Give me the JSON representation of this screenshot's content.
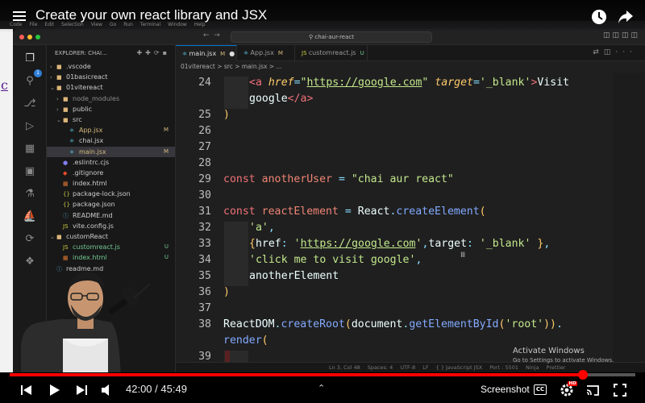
{
  "video": {
    "title": "Create your own react library and JSX",
    "time_current": "42:00",
    "time_total": "45:49",
    "time_separator": "/",
    "progress": 0.916,
    "screenshot_label": "Screenshot",
    "cc_label": "CC",
    "hd_label": "HD"
  },
  "mac_menubar": [
    "Code",
    "File",
    "Edit",
    "Selection",
    "View",
    "Go",
    "Run",
    "Terminal",
    "Window",
    "Help"
  ],
  "vscode": {
    "command_center": "chai-aur-react",
    "activity_badge": "1",
    "explorer_title": "EXPLORER: CHAI...",
    "tree": [
      {
        "label": ".vscode",
        "depth": 1,
        "kind": "folder",
        "open": false,
        "status": "",
        "color": "#cccccc"
      },
      {
        "label": "01basicreact",
        "depth": 1,
        "kind": "folder",
        "open": false,
        "status": "",
        "color": "#cccccc"
      },
      {
        "label": "01vitereact",
        "depth": 1,
        "kind": "folder",
        "open": true,
        "status": "",
        "color": "#cccccc"
      },
      {
        "label": "node_modules",
        "depth": 2,
        "kind": "folder",
        "open": false,
        "status": "",
        "color": "#8c8c8c"
      },
      {
        "label": "public",
        "depth": 2,
        "kind": "folder",
        "open": false,
        "status": "",
        "color": "#cccccc"
      },
      {
        "label": "src",
        "depth": 2,
        "kind": "folder",
        "open": true,
        "status": "",
        "color": "#cccccc"
      },
      {
        "label": "App.jsx",
        "depth": 3,
        "kind": "react",
        "open": false,
        "status": "M",
        "color": "#d7ba7d"
      },
      {
        "label": "chai.jsx",
        "depth": 3,
        "kind": "react",
        "open": false,
        "status": "",
        "color": "#cccccc"
      },
      {
        "label": "main.jsx",
        "depth": 3,
        "kind": "react",
        "open": false,
        "status": "M",
        "color": "#d7ba7d",
        "selected": true
      },
      {
        "label": ".eslintrc.cjs",
        "depth": 2,
        "kind": "eslint",
        "open": false,
        "status": "",
        "color": "#cccccc"
      },
      {
        "label": ".gitignore",
        "depth": 2,
        "kind": "git",
        "open": false,
        "status": "",
        "color": "#cccccc"
      },
      {
        "label": "index.html",
        "depth": 2,
        "kind": "html",
        "open": false,
        "status": "",
        "color": "#cccccc"
      },
      {
        "label": "package-lock.json",
        "depth": 2,
        "kind": "json",
        "open": false,
        "status": "",
        "color": "#cccccc"
      },
      {
        "label": "package.json",
        "depth": 2,
        "kind": "json",
        "open": false,
        "status": "",
        "color": "#cccccc"
      },
      {
        "label": "README.md",
        "depth": 2,
        "kind": "info",
        "open": false,
        "status": "",
        "color": "#cccccc"
      },
      {
        "label": "vite.config.js",
        "depth": 2,
        "kind": "js",
        "open": false,
        "status": "",
        "color": "#cccccc"
      },
      {
        "label": "customReact",
        "depth": 1,
        "kind": "folder",
        "open": true,
        "status": "",
        "color": "#cccccc"
      },
      {
        "label": "customreact.js",
        "depth": 2,
        "kind": "js",
        "open": false,
        "status": "U",
        "color": "#73c991"
      },
      {
        "label": "index.html",
        "depth": 2,
        "kind": "html",
        "open": false,
        "status": "U",
        "color": "#73c991"
      },
      {
        "label": "readme.md",
        "depth": 1,
        "kind": "info",
        "open": false,
        "status": "",
        "color": "#cccccc"
      }
    ],
    "tabs": [
      {
        "label": "main.jsx",
        "status": "M",
        "active": true,
        "dirty": true
      },
      {
        "label": "App.jsx",
        "status": "M",
        "active": false,
        "dirty": false
      },
      {
        "label": "customreact.js",
        "status": "U",
        "active": false,
        "dirty": false
      }
    ],
    "breadcrumb": "01vitereact > src > main.jsx > ...",
    "lines": [
      {
        "n": "24",
        "indent": 1,
        "tokens": [
          [
            "tag",
            "<a "
          ],
          [
            "attr",
            "href"
          ],
          [
            "punc",
            "="
          ],
          [
            "str",
            "\""
          ],
          [
            "str lnk",
            "https://google.com"
          ],
          [
            "str",
            "\""
          ],
          [
            "plain",
            " "
          ],
          [
            "attr",
            "target"
          ],
          [
            "punc",
            "="
          ],
          [
            "str",
            "'_blank'"
          ],
          [
            "tag",
            ">"
          ],
          [
            "plain",
            "Visit"
          ]
        ]
      },
      {
        "n": "",
        "indent": 1,
        "tokens": [
          [
            "plain",
            "google"
          ],
          [
            "tag",
            "</a>"
          ]
        ]
      },
      {
        "n": "25",
        "indent": 0,
        "tokens": [
          [
            "par",
            ")"
          ]
        ]
      },
      {
        "n": "26",
        "indent": 0,
        "tokens": []
      },
      {
        "n": "27",
        "indent": 0,
        "tokens": []
      },
      {
        "n": "28",
        "indent": 0,
        "tokens": []
      },
      {
        "n": "29",
        "indent": 0,
        "tokens": [
          [
            "kw",
            "const "
          ],
          [
            "var",
            "anotherUser"
          ],
          [
            "plain",
            " "
          ],
          [
            "punc",
            "="
          ],
          [
            "plain",
            " "
          ],
          [
            "str",
            "\"chai aur react\""
          ]
        ]
      },
      {
        "n": "30",
        "indent": 0,
        "tokens": []
      },
      {
        "n": "31",
        "indent": 0,
        "tokens": [
          [
            "kw",
            "const "
          ],
          [
            "var",
            "reactElement"
          ],
          [
            "plain",
            " "
          ],
          [
            "punc",
            "="
          ],
          [
            "plain",
            " React"
          ],
          [
            "punc",
            "."
          ],
          [
            "fn",
            "createElement"
          ],
          [
            "par",
            "("
          ]
        ]
      },
      {
        "n": "32",
        "indent": 1,
        "tokens": [
          [
            "str",
            "'a'"
          ],
          [
            "punc",
            ","
          ]
        ]
      },
      {
        "n": "33",
        "indent": 1,
        "tokens": [
          [
            "par",
            "{"
          ],
          [
            "plain",
            "href"
          ],
          [
            "punc",
            ": "
          ],
          [
            "str",
            "'"
          ],
          [
            "str lnk",
            "https://google.com"
          ],
          [
            "str",
            "'"
          ],
          [
            "punc",
            ","
          ],
          [
            "plain",
            "target"
          ],
          [
            "punc",
            ": "
          ],
          [
            "str",
            "'_blank'"
          ],
          [
            "plain",
            " "
          ],
          [
            "par",
            "}"
          ],
          [
            "punc",
            ","
          ]
        ]
      },
      {
        "n": "34",
        "indent": 1,
        "tokens": [
          [
            "str",
            "'click me to visit google'"
          ],
          [
            "punc",
            ","
          ]
        ]
      },
      {
        "n": "35",
        "indent": 1,
        "tokens": [
          [
            "plain",
            "anotherElement"
          ]
        ]
      },
      {
        "n": "36",
        "indent": 0,
        "tokens": [
          [
            "par",
            ")"
          ]
        ]
      },
      {
        "n": "37",
        "indent": 0,
        "tokens": []
      },
      {
        "n": "38",
        "indent": 0,
        "tokens": [
          [
            "plain",
            "ReactDOM"
          ],
          [
            "punc",
            "."
          ],
          [
            "fn",
            "createRoot"
          ],
          [
            "par",
            "("
          ],
          [
            "plain",
            "document"
          ],
          [
            "punc",
            "."
          ],
          [
            "fn",
            "getElementById"
          ],
          [
            "par",
            "("
          ],
          [
            "str",
            "'root'"
          ],
          [
            "par",
            "))"
          ],
          [
            "punc",
            "."
          ]
        ]
      },
      {
        "n": "",
        "indent": 0,
        "tokens": [
          [
            "fn",
            "render"
          ],
          [
            "par",
            "("
          ]
        ]
      },
      {
        "n": "39",
        "indent": 1,
        "tokens": []
      }
    ],
    "statusbar": [
      "Ln 3, Col 48",
      "Spaces: 4",
      "UTF-8",
      "LF",
      "{ } JavaScript JSX",
      "Port : 5501",
      "Ninja",
      "Prettier"
    ],
    "activate_title": "Activate Windows",
    "activate_sub": "Go to Settings to activate Windows."
  },
  "colors": {
    "accent": "#0078d4",
    "youtube_red": "#ff0000",
    "modified": "#d7ba7d",
    "untracked": "#73c991"
  }
}
